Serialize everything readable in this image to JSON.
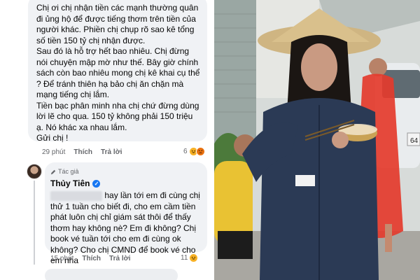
{
  "comment1": {
    "paragraphs": [
      "Chị ơi chị nhận tiền các mạnh thường quân đi ủng hộ để được tiếng thơm trên tiền của người khác. Phiền chị chụp rõ sao kê tổng số tiền 150 tỷ chị nhận được.",
      "Sau đó là hỗ trợ hết bao nhiêu. Chị đừng nói chuyện mập mờ như thế. Bây giờ chính sách còn bao nhiêu mong chị kê khai cụ thể ? Để tránh thiên hạ bảo chị ăn chặn mà mạng tiếng chị lắm.",
      "Tiền bạc phân minh nha chị chứ đừng dùng lời lẽ cho qua. 150 tỷ không phải 150 triệu ạ. Nó khác xa nhau lắm.",
      "Gửi chị !"
    ],
    "time": "29 phút",
    "like": "Thích",
    "reply": "Trả lời",
    "reaction_count": "6"
  },
  "comment2": {
    "badge": "Tác giả",
    "author": "Thủy Tiên",
    "text": "hay lần tới em đi cùng chị thử 1 tuần cho biết đi, cho em cầm tiền phát luôn chị chỉ giám sát thôi để thấy thơm hay không nè? Em đi không? Chị book vé tuần tới cho em đi cùng ok không? Cho chị CMND để book vé cho em nha",
    "time": "15 phút",
    "like": "Thích",
    "reply": "Trả lời",
    "reaction_count": "11"
  },
  "photo": {
    "van_plate": "64"
  },
  "icons": {
    "haha": "haha-reaction-icon",
    "angry": "angry-reaction-icon",
    "verified": "verified-badge-icon",
    "author": "author-pen-icon"
  },
  "colors": {
    "bubble": "#f0f2f5",
    "meta": "#65676b",
    "verified": "#1877f2",
    "raincoat": "#e43b2c"
  }
}
